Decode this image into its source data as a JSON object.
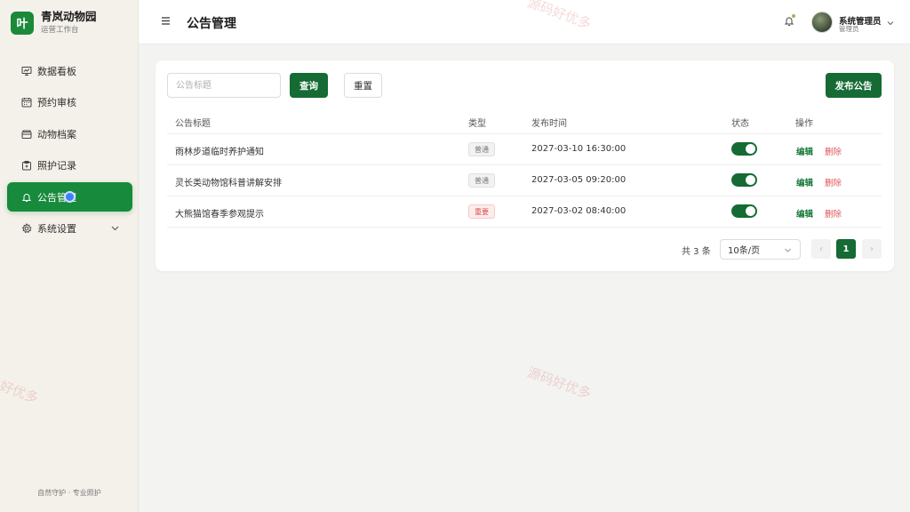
{
  "brand": {
    "logo": "叶",
    "title": "青岚动物园",
    "subtitle": "运营工作台"
  },
  "sidebar": {
    "items": [
      {
        "label": "数据看板",
        "icon": "dashboard-icon"
      },
      {
        "label": "预约审核",
        "icon": "calendar-icon"
      },
      {
        "label": "动物档案",
        "icon": "archive-icon"
      },
      {
        "label": "照护记录",
        "icon": "care-record-icon"
      },
      {
        "label": "公告管理",
        "icon": "bell-icon",
        "active": true
      },
      {
        "label": "系统设置",
        "icon": "gear-icon"
      }
    ],
    "footer": "自然守护 · 专业照护"
  },
  "header": {
    "title": "公告管理",
    "user": {
      "name": "系统管理员",
      "role": "管理员"
    }
  },
  "toolbar": {
    "search_placeholder": "公告标题",
    "search_value": "",
    "query_label": "查询",
    "reset_label": "重置",
    "publish_label": "发布公告"
  },
  "table": {
    "columns": [
      "公告标题",
      "类型",
      "发布时间",
      "状态",
      "操作"
    ],
    "rows": [
      {
        "title": "雨林步道临时养护通知",
        "type": "普通",
        "time": "2027-03-10 16:30:00",
        "enabled": true
      },
      {
        "title": "灵长类动物馆科普讲解安排",
        "type": "普通",
        "time": "2027-03-05 09:20:00",
        "enabled": true
      },
      {
        "title": "大熊猫馆春季参观提示",
        "type": "重要",
        "time": "2027-03-02 08:40:00",
        "enabled": true
      }
    ],
    "actions": {
      "edit": "编辑",
      "delete": "删除"
    }
  },
  "pagination": {
    "total_text": "共 3 条",
    "page_size": "10条/页",
    "current_page": "1",
    "prev": "‹",
    "next": "›"
  },
  "watermark": "源码好优多",
  "colors": {
    "primary": "#156b33",
    "accent": "#178a3c",
    "danger": "#e05555"
  }
}
